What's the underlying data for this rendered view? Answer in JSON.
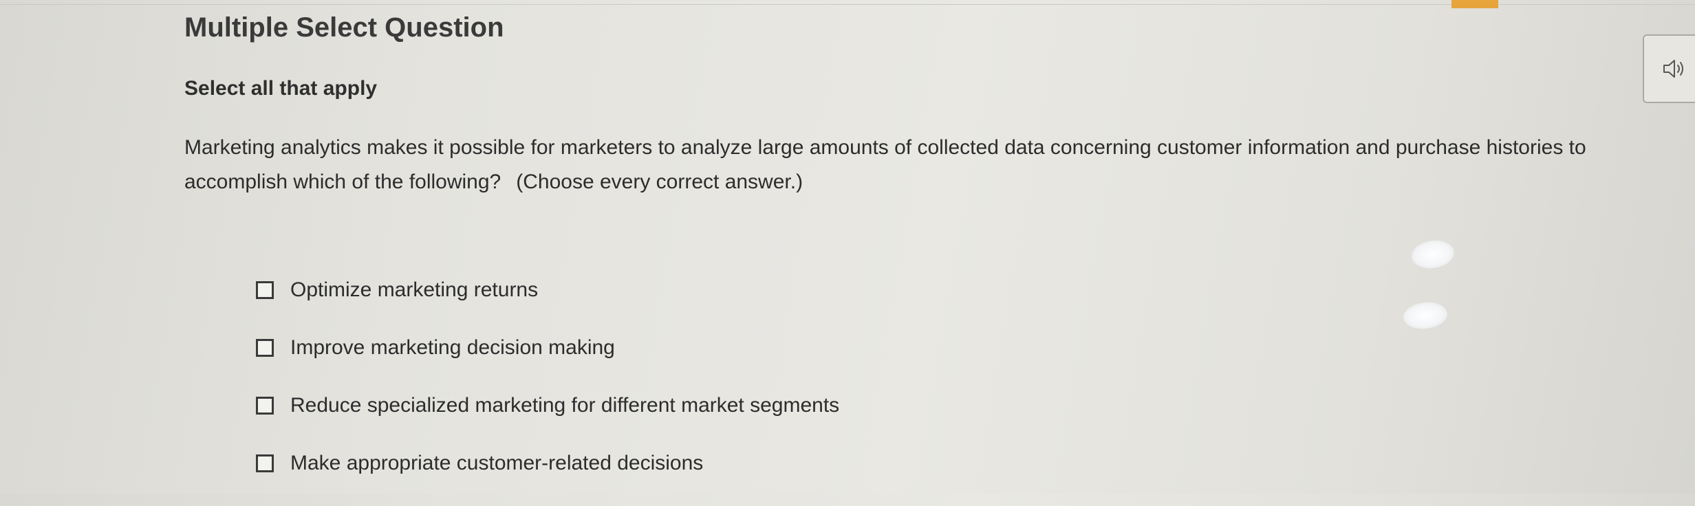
{
  "question": {
    "type_label": "Multiple Select Question",
    "instruction": "Select all that apply",
    "prompt_main": "Marketing analytics makes it possible for marketers to analyze large amounts of collected data concerning customer information and purchase histories to accomplish which of the following?",
    "prompt_note": "(Choose every correct answer.)"
  },
  "options": [
    {
      "label": "Optimize marketing returns",
      "checked": false
    },
    {
      "label": "Improve marketing decision making",
      "checked": false
    },
    {
      "label": "Reduce specialized marketing for different market segments",
      "checked": false
    },
    {
      "label": "Make appropriate customer-related decisions",
      "checked": false
    }
  ],
  "toolbar": {
    "audio_icon": "speaker-icon"
  },
  "colors": {
    "accent": "#e6a43a",
    "text": "#2c2c2c",
    "background": "#e6e5e0"
  }
}
